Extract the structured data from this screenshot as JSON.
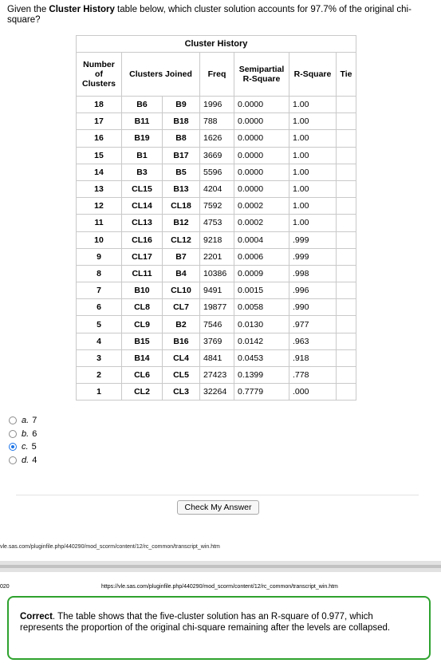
{
  "question": {
    "before": "Given the ",
    "bold": "Cluster History",
    "after": " table below, which cluster solution accounts for 97.7% of the original chi-square?"
  },
  "table": {
    "caption": "Cluster History",
    "headers": {
      "num": "Number of Clusters",
      "joined": "Clusters Joined",
      "freq": "Freq",
      "spr": "Semipartial R-Square",
      "rsq": "R-Square",
      "tie": "Tie"
    },
    "rows": [
      {
        "num": "18",
        "j1": "B6",
        "j2": "B9",
        "freq": "1996",
        "spr": "0.0000",
        "rsq": "1.00",
        "tie": ""
      },
      {
        "num": "17",
        "j1": "B11",
        "j2": "B18",
        "freq": "788",
        "spr": "0.0000",
        "rsq": "1.00",
        "tie": ""
      },
      {
        "num": "16",
        "j1": "B19",
        "j2": "B8",
        "freq": "1626",
        "spr": "0.0000",
        "rsq": "1.00",
        "tie": ""
      },
      {
        "num": "15",
        "j1": "B1",
        "j2": "B17",
        "freq": "3669",
        "spr": "0.0000",
        "rsq": "1.00",
        "tie": ""
      },
      {
        "num": "14",
        "j1": "B3",
        "j2": "B5",
        "freq": "5596",
        "spr": "0.0000",
        "rsq": "1.00",
        "tie": ""
      },
      {
        "num": "13",
        "j1": "CL15",
        "j2": "B13",
        "freq": "4204",
        "spr": "0.0000",
        "rsq": "1.00",
        "tie": ""
      },
      {
        "num": "12",
        "j1": "CL14",
        "j2": "CL18",
        "freq": "7592",
        "spr": "0.0002",
        "rsq": "1.00",
        "tie": ""
      },
      {
        "num": "11",
        "j1": "CL13",
        "j2": "B12",
        "freq": "4753",
        "spr": "0.0002",
        "rsq": "1.00",
        "tie": ""
      },
      {
        "num": "10",
        "j1": "CL16",
        "j2": "CL12",
        "freq": "9218",
        "spr": "0.0004",
        "rsq": ".999",
        "tie": ""
      },
      {
        "num": "9",
        "j1": "CL17",
        "j2": "B7",
        "freq": "2201",
        "spr": "0.0006",
        "rsq": ".999",
        "tie": ""
      },
      {
        "num": "8",
        "j1": "CL11",
        "j2": "B4",
        "freq": "10386",
        "spr": "0.0009",
        "rsq": ".998",
        "tie": ""
      },
      {
        "num": "7",
        "j1": "B10",
        "j2": "CL10",
        "freq": "9491",
        "spr": "0.0015",
        "rsq": ".996",
        "tie": ""
      },
      {
        "num": "6",
        "j1": "CL8",
        "j2": "CL7",
        "freq": "19877",
        "spr": "0.0058",
        "rsq": ".990",
        "tie": ""
      },
      {
        "num": "5",
        "j1": "CL9",
        "j2": "B2",
        "freq": "7546",
        "spr": "0.0130",
        "rsq": ".977",
        "tie": ""
      },
      {
        "num": "4",
        "j1": "B15",
        "j2": "B16",
        "freq": "3769",
        "spr": "0.0142",
        "rsq": ".963",
        "tie": ""
      },
      {
        "num": "3",
        "j1": "B14",
        "j2": "CL4",
        "freq": "4841",
        "spr": "0.0453",
        "rsq": ".918",
        "tie": ""
      },
      {
        "num": "2",
        "j1": "CL6",
        "j2": "CL5",
        "freq": "27423",
        "spr": "0.1399",
        "rsq": ".778",
        "tie": ""
      },
      {
        "num": "1",
        "j1": "CL2",
        "j2": "CL3",
        "freq": "32264",
        "spr": "0.7779",
        "rsq": ".000",
        "tie": ""
      }
    ]
  },
  "options": [
    {
      "letter": "a.",
      "value": "7",
      "checked": false
    },
    {
      "letter": "b.",
      "value": "6",
      "checked": false
    },
    {
      "letter": "c.",
      "value": "5",
      "checked": true
    },
    {
      "letter": "d.",
      "value": "4",
      "checked": false
    }
  ],
  "check_button": "Check My Answer",
  "url_top": "vle.sas.com/pluginfile.php/440290/mod_scorm/content/12/rc_common/transcript_win.htm",
  "year_fragment": "020",
  "url_bottom": "https://vle.sas.com/pluginfile.php/440290/mod_scorm/content/12/rc_common/transcript_win.htm",
  "feedback": {
    "bold": "Correct",
    "text": ". The table shows that the five-cluster solution has an R-square of 0.977, which represents the proportion of the original chi-square remaining after the levels are collapsed.",
    "border_color": "#2ea22e"
  }
}
